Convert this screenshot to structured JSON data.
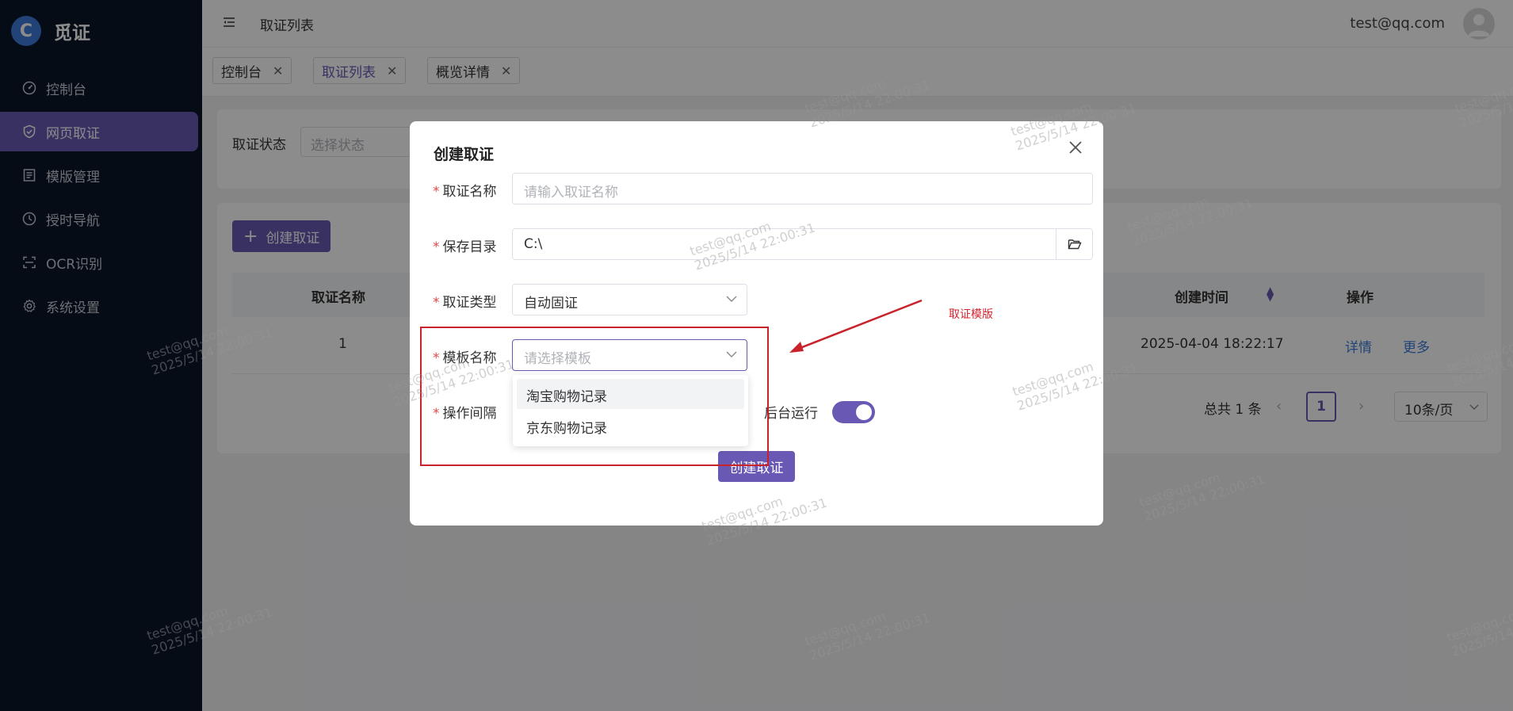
{
  "brand": {
    "logo": "C",
    "name": "觅证"
  },
  "sidebar": {
    "items": [
      {
        "label": "控制台",
        "icon": "dashboard-icon"
      },
      {
        "label": "网页取证",
        "icon": "shield-icon",
        "active": true
      },
      {
        "label": "模版管理",
        "icon": "template-icon"
      },
      {
        "label": "授时导航",
        "icon": "clock-icon"
      },
      {
        "label": "OCR识别",
        "icon": "scan-icon"
      },
      {
        "label": "系统设置",
        "icon": "gear-icon"
      }
    ]
  },
  "header": {
    "title": "取证列表",
    "user_email": "test@qq.com"
  },
  "tabs": [
    {
      "label": "控制台"
    },
    {
      "label": "取证列表",
      "active": true
    },
    {
      "label": "概览详情"
    }
  ],
  "filter": {
    "label": "取证状态",
    "placeholder": "选择状态"
  },
  "table": {
    "create_label": "创建取证",
    "columns": {
      "name": "取证名称",
      "created": "创建时间",
      "actions": "操作"
    },
    "rows": [
      {
        "name": "1",
        "created": "2025-04-04 18:22:17",
        "detail": "详情",
        "more": "更多"
      }
    ]
  },
  "pagination": {
    "total": "总共 1 条",
    "page": "1",
    "page_size": "10条/页"
  },
  "dialog": {
    "title": "创建取证",
    "fields": {
      "name": {
        "label": "取证名称",
        "placeholder": "请输入取证名称"
      },
      "dir": {
        "label": "保存目录",
        "value": "C:\\"
      },
      "type": {
        "label": "取证类型",
        "value": "自动固证"
      },
      "template": {
        "label": "模板名称",
        "placeholder": "请选择模板"
      },
      "interval": {
        "label": "操作间隔"
      },
      "background": {
        "label": "后台运行",
        "enabled": true
      }
    },
    "template_options": [
      "淘宝购物记录",
      "京东购物记录"
    ],
    "submit_label": "创建取证"
  },
  "annotation": {
    "text": "取证模版",
    "color": "#c9222b"
  },
  "watermark": {
    "line1": "test@qq.com",
    "line2": "2025/5/14 22:00:31"
  },
  "colors": {
    "accent": "#6a59b4",
    "sidebar_bg": "#0b1628",
    "link": "#3d7bd9"
  }
}
